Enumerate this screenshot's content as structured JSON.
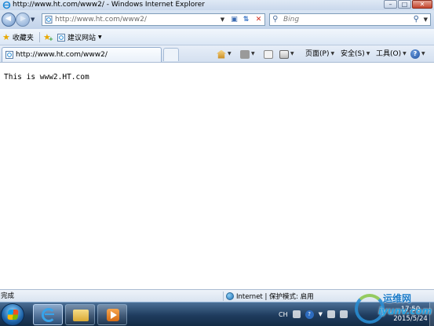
{
  "window": {
    "title": "http://www.ht.com/www2/ - Windows Internet Explorer",
    "controls": [
      "minimize",
      "maximize",
      "close"
    ]
  },
  "address_bar": {
    "url": "http://www.ht.com/www2/"
  },
  "search": {
    "placeholder": "Bing"
  },
  "favorites_bar": {
    "favorites_label": "收藏夹",
    "suggested_sites_label": "建议网站"
  },
  "tabs": [
    {
      "label": "http://www.ht.com/www2/",
      "active": true
    }
  ],
  "command_bar": {
    "page_label": "页面(P)",
    "safety_label": "安全(S)",
    "tools_label": "工具(O)",
    "help_glyph": "?"
  },
  "page": {
    "body_text": "This is www2.HT.com"
  },
  "status_bar": {
    "status": "完成",
    "zone": "Internet | 保护模式: 启用"
  },
  "taskbar": {
    "tray_lang": "CH",
    "clock_time": "17:50",
    "clock_date": "2015/5/24"
  },
  "watermark": {
    "cn": "运维网",
    "en": "iyunv.com"
  },
  "colors": {
    "title_bar": "#c9d8ec",
    "taskbar": "#1f3c5e",
    "close_button": "#c4442d",
    "accent_blue": "#2f6ec4"
  }
}
